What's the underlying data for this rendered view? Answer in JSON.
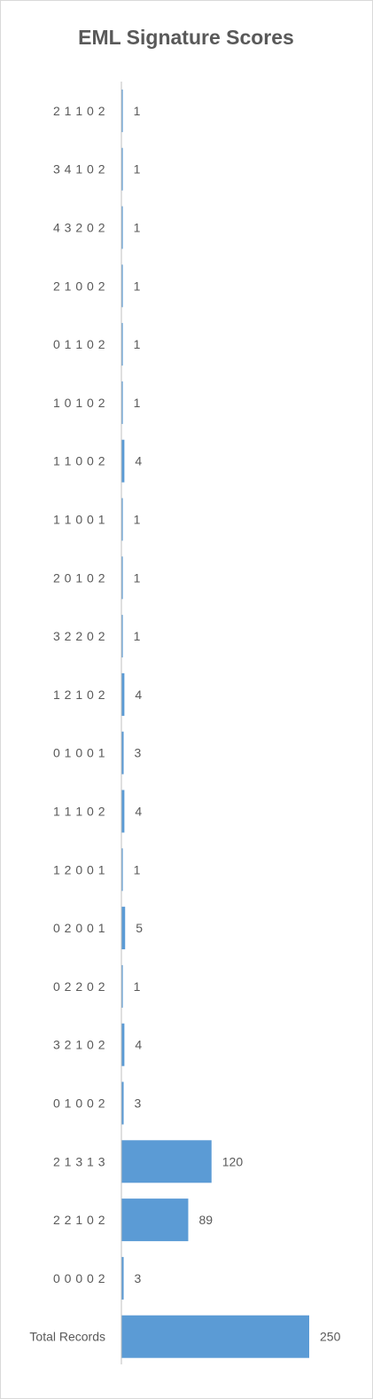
{
  "chart_data": {
    "type": "bar",
    "orientation": "horizontal",
    "title": "EML Signature Scores",
    "xlabel": "",
    "ylabel": "",
    "categories": [
      "2 1 1 0 2",
      "3 4 1 0 2",
      "4 3 2 0 2",
      "2 1 0 0 2",
      "0 1 1 0 2",
      "1 0 1 0 2",
      "1 1 0 0 2",
      "1 1 0 0 1",
      "2 0 1 0 2",
      "3 2 2 0 2",
      "1 2 1 0 2",
      "0 1 0 0 1",
      "1 1 1 0 2",
      "1 2 0 0 1",
      "0 2 0 0 1",
      "0 2 2 0 2",
      "3 2 1 0 2",
      "0 1 0 0 2",
      "2 1 3 1 3",
      "2 2 1 0 2",
      "0 0 0 0 2",
      "Total Records"
    ],
    "values": [
      1,
      1,
      1,
      1,
      1,
      1,
      4,
      1,
      1,
      1,
      4,
      3,
      4,
      1,
      5,
      1,
      4,
      3,
      120,
      89,
      3,
      250
    ],
    "xlim": [
      0,
      250
    ],
    "grid": false,
    "legend": "none",
    "data_labels": true,
    "colors": {
      "bar": "#5b9bd5",
      "axis": "#bfbfbf",
      "text": "#595959",
      "border": "#d9d9d9"
    }
  }
}
